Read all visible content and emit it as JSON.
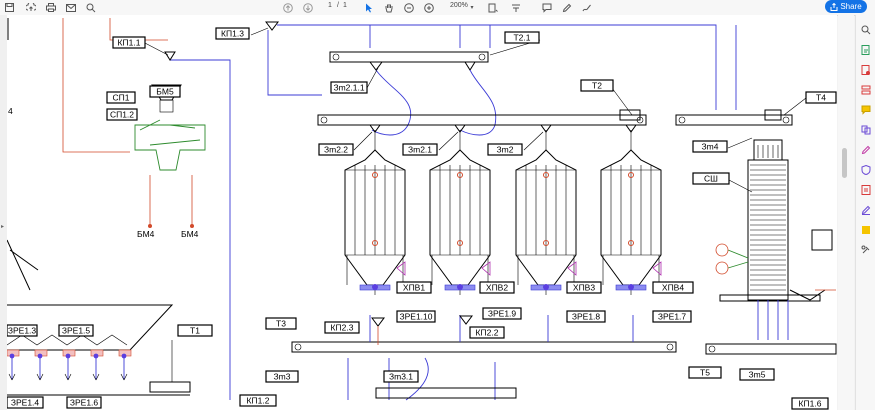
{
  "toolbar": {
    "page_current": "1",
    "page_sep": "/",
    "page_total": "1",
    "zoom": "200%",
    "share_label": "Share",
    "icons": [
      "save-icon",
      "upload-icon",
      "print-icon",
      "email-icon",
      "zoom-search-icon",
      "page-up-icon",
      "page-down-icon",
      "zoom-out-icon",
      "zoom-in-icon",
      "zoom-dropdown-icon",
      "select-arrow-icon",
      "hand-pan-icon",
      "rotate-icon",
      "page-fit-icon",
      "page-width-icon",
      "comment-icon",
      "pen-icon",
      "sign-icon",
      "share-icon"
    ]
  },
  "right_tools": [
    "search-tool-icon",
    "edit-pdf-icon",
    "export-pdf-icon",
    "organize-pages-icon",
    "comment-tool-icon",
    "combine-icon",
    "fill-sign-icon",
    "protect-icon",
    "form-icon",
    "measure-icon",
    "scan-icon",
    "more-tools-icon"
  ],
  "colors": {
    "accent": "#1473e6",
    "drawing": "#000000",
    "blue_line": "#3b3bd6",
    "red_line": "#d24a2a",
    "green": "#2e8b2e",
    "magenta": "#b030b0"
  },
  "drawing": {
    "labels": {
      "kp11": "КП1.1",
      "kp13": "КП1.3",
      "t21": "Т2.1",
      "t2": "Т2",
      "t4": "Т4",
      "bm5": "БМ5",
      "sp1": "СП1",
      "sp12": "СП1.2",
      "zm211": "Зm2.1.1",
      "zm22": "Зm2.2",
      "zm21": "Зm2.1",
      "zm2": "Зm2",
      "zm4": "Зm4",
      "sh": "СШ",
      "bm4a": "БМ4",
      "bm4b": "БМ4",
      "xp1": "ХПВ1",
      "xp2": "ХПВ2",
      "xp3": "ХПВ3",
      "xp4": "ХПВ4",
      "zre110": "ЗРЕ1.10",
      "zre19": "ЗРЕ1.9",
      "zre18": "ЗРЕ1.8",
      "zre17": "ЗРЕ1.7",
      "kp23": "КП2.3",
      "kp22": "КП2.2",
      "t3": "Т3",
      "zre13": "ЗРЕ1.3",
      "zre15": "ЗРЕ1.5",
      "t1": "Т1",
      "zre14": "ЗРЕ1.4",
      "zre16": "ЗРЕ1.6",
      "zm3": "Зm3",
      "zm31": "Зm3.1",
      "kp12": "КП1.2",
      "t5": "Т5",
      "zm5": "Зm5",
      "kp16": "КП1.6",
      "edge4": "4"
    }
  }
}
